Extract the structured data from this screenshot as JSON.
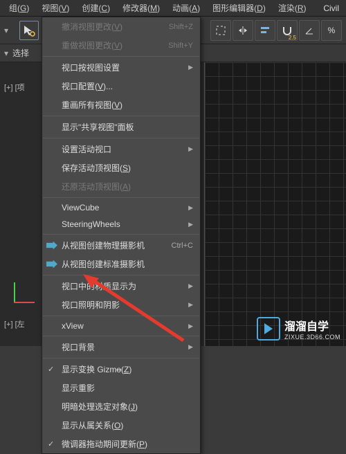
{
  "menubar": {
    "items": [
      {
        "label": "组",
        "key": "G"
      },
      {
        "label": "视图",
        "key": "V"
      },
      {
        "label": "创建",
        "key": "C"
      },
      {
        "label": "修改器",
        "key": "M"
      },
      {
        "label": "动画",
        "key": "A"
      },
      {
        "label": "图形编辑器",
        "key": "D"
      },
      {
        "label": "渲染",
        "key": "R"
      }
    ],
    "right": "Civil"
  },
  "subrow": {
    "label": "选择"
  },
  "toolbar_right": {
    "badge": "2.5"
  },
  "viewport": {
    "label_tl": "[+] [项",
    "label_bl": "[+] [左"
  },
  "menu": {
    "undo": {
      "label": "撤消视图更改",
      "key": "V",
      "shortcut": "Shift+Z"
    },
    "redo": {
      "label": "重做视图更改",
      "key": "V",
      "shortcut": "Shift+Y"
    },
    "byView": "视口按视图设置",
    "config": {
      "label": "视口配置",
      "key": "V"
    },
    "redraw": {
      "label": "重画所有视图",
      "key": "V"
    },
    "sharedPanel": "显示\"共享视图\"面板",
    "setActive": "设置活动视口",
    "saveActive": {
      "label": "保存活动顶视图",
      "key": "S"
    },
    "restoreActive": {
      "label": "还原活动顶视图",
      "key": "A"
    },
    "viewcube": "ViewCube",
    "steering": "SteeringWheels",
    "camPhys": {
      "label": "从视图创建物理摄影机",
      "shortcut": "Ctrl+C"
    },
    "camStd": "从视图创建标准摄影机",
    "matDisplay": "视口中的材质显示为",
    "lighting": "视口照明和阴影",
    "xview": "xView",
    "bg": "视口背景",
    "gizmo": {
      "label": "显示变换 Gizm",
      "key": "Z"
    },
    "ghost": "显示重影",
    "keyBrackets": {
      "label": "明暗处理选定对象",
      "key": "J"
    },
    "deps": {
      "label": "显示从属关系",
      "key": "O"
    },
    "nudge": {
      "label": "微调器拖动期间更新",
      "key": "P"
    }
  },
  "watermark": {
    "line1": "溜溜自学",
    "line2": "ZIXUE.3D66.COM"
  }
}
